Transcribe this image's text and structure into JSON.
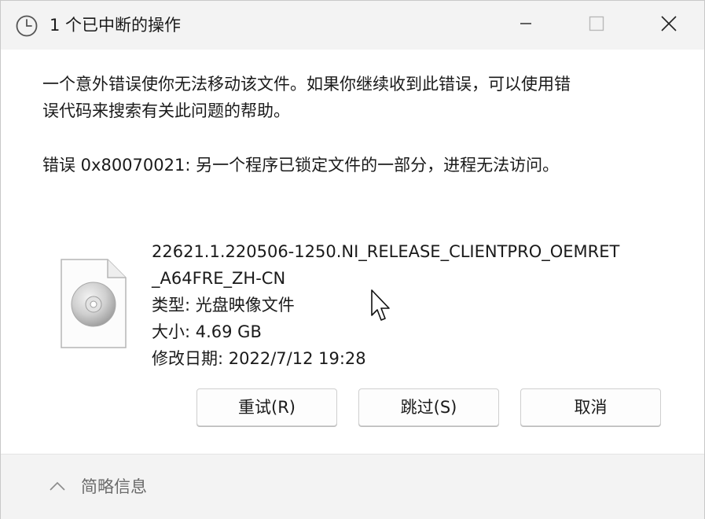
{
  "window": {
    "title": "1 个已中断的操作",
    "controls": {
      "minimize_icon": "minimize-icon",
      "maximize_icon": "maximize-icon",
      "close_icon": "close-icon"
    }
  },
  "message": {
    "line1": "一个意外错误使你无法移动该文件。如果你继续收到此错误，可以使用错",
    "line2": "误代码来搜索有关此问题的帮助。",
    "error": "错误 0x80070021: 另一个程序已锁定文件的一部分，进程无法访问。"
  },
  "file": {
    "icon": "disc-image-file-icon",
    "name_line1": "22621.1.220506-1250.NI_RELEASE_CLIENTPRO_OEMRET",
    "name_line2": "_A64FRE_ZH-CN",
    "type": "类型: 光盘映像文件",
    "size": "大小: 4.69 GB",
    "modified": "修改日期: 2022/7/12 19:28"
  },
  "buttons": {
    "retry": "重试(R)",
    "skip": "跳过(S)",
    "cancel": "取消"
  },
  "footer": {
    "toggle_label": "简略信息",
    "toggle_icon": "chevron-up-icon"
  },
  "colors": {
    "titlebar_bg": "#f3f3f3",
    "footer_bg": "#f3f3f3",
    "footer_text": "#6b6b6b"
  }
}
